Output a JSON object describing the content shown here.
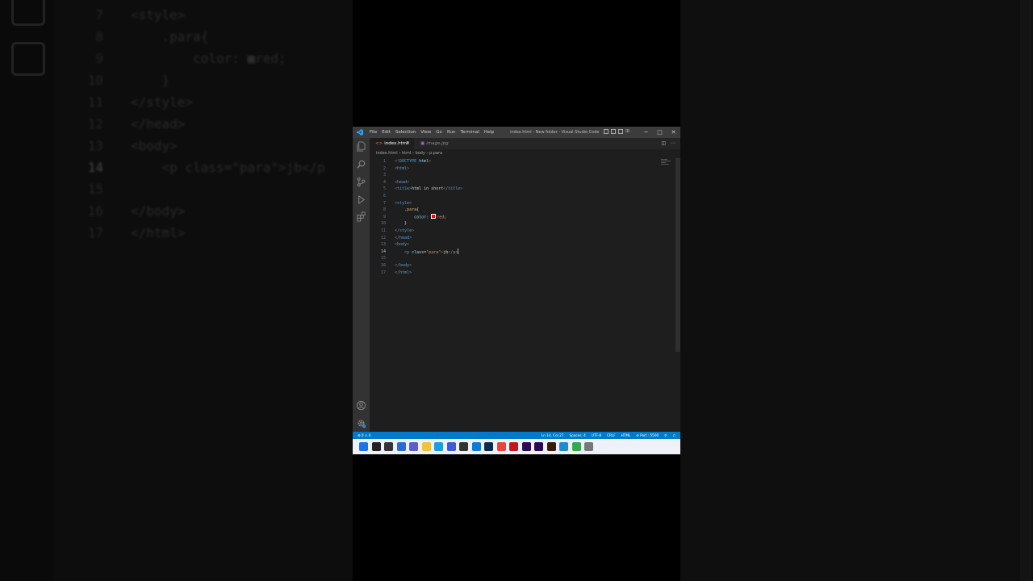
{
  "background": {
    "lines": [
      {
        "num": "7",
        "code": "<style>"
      },
      {
        "num": "8",
        "code": "    .para{"
      },
      {
        "num": "9",
        "code": "        color: ■red;"
      },
      {
        "num": "10",
        "code": "    }"
      },
      {
        "num": "11",
        "code": "</style>"
      },
      {
        "num": "12",
        "code": "</head>"
      },
      {
        "num": "13",
        "code": "<body>"
      },
      {
        "num": "14",
        "code": "    <p class=\"para\">jb</p"
      },
      {
        "num": "15",
        "code": ""
      },
      {
        "num": "16",
        "code": "</body>"
      },
      {
        "num": "17",
        "code": "</html>"
      }
    ]
  },
  "window": {
    "title": "index.html - New folder - Visual Studio Code",
    "menu": [
      "File",
      "Edit",
      "Selection",
      "View",
      "Go",
      "Run",
      "Terminal",
      "Help"
    ],
    "controls": {
      "minimize": "─",
      "maximize": "□",
      "close": "✕"
    }
  },
  "tabs": [
    {
      "label": "index.html",
      "active": true,
      "close": "✕"
    },
    {
      "label": "image.jpg",
      "active": false
    }
  ],
  "breadcrumb": [
    "index.html",
    "html",
    "body",
    "p.para"
  ],
  "editor": {
    "current_line": 14,
    "lines": [
      {
        "num": "1",
        "tokens": [
          [
            "br",
            "<!"
          ],
          [
            "tag",
            "DOCTYPE"
          ],
          [
            "text",
            " "
          ],
          [
            "attr",
            "html"
          ],
          [
            "br",
            ">"
          ]
        ]
      },
      {
        "num": "2",
        "tokens": [
          [
            "br",
            "<"
          ],
          [
            "tag",
            "html"
          ],
          [
            "br",
            ">"
          ]
        ]
      },
      {
        "num": "3",
        "tokens": []
      },
      {
        "num": "4",
        "tokens": [
          [
            "br",
            "<"
          ],
          [
            "tag",
            "head"
          ],
          [
            "br",
            ">"
          ]
        ]
      },
      {
        "num": "5",
        "tokens": [
          [
            "br",
            "<"
          ],
          [
            "tag",
            "title"
          ],
          [
            "br",
            ">"
          ],
          [
            "text",
            "html in short"
          ],
          [
            "br",
            "</"
          ],
          [
            "tag",
            "title"
          ],
          [
            "br",
            ">"
          ]
        ]
      },
      {
        "num": "6",
        "tokens": []
      },
      {
        "num": "7",
        "tokens": [
          [
            "br",
            "<"
          ],
          [
            "tag",
            "style"
          ],
          [
            "br",
            ">"
          ]
        ]
      },
      {
        "num": "8",
        "tokens": [
          [
            "text",
            "    "
          ],
          [
            "sel",
            ".para"
          ],
          [
            "text",
            "{"
          ]
        ]
      },
      {
        "num": "9",
        "tokens": [
          [
            "text",
            "        "
          ],
          [
            "prop",
            "color"
          ],
          [
            "text",
            ": "
          ],
          [
            "swatch",
            ""
          ],
          [
            "str",
            "red"
          ],
          [
            "text",
            ";"
          ]
        ]
      },
      {
        "num": "10",
        "tokens": [
          [
            "text",
            "    }"
          ]
        ]
      },
      {
        "num": "11",
        "tokens": [
          [
            "br",
            "</"
          ],
          [
            "tag",
            "style"
          ],
          [
            "br",
            ">"
          ]
        ]
      },
      {
        "num": "12",
        "tokens": [
          [
            "br",
            "</"
          ],
          [
            "tag",
            "head"
          ],
          [
            "br",
            ">"
          ]
        ]
      },
      {
        "num": "13",
        "tokens": [
          [
            "br",
            "<"
          ],
          [
            "tag",
            "body"
          ],
          [
            "br",
            ">"
          ]
        ]
      },
      {
        "num": "14",
        "tokens": [
          [
            "text",
            "    "
          ],
          [
            "br",
            "<"
          ],
          [
            "tag",
            "p"
          ],
          [
            "text",
            " "
          ],
          [
            "attr",
            "class"
          ],
          [
            "text",
            "="
          ],
          [
            "str",
            "\"para\""
          ],
          [
            "br",
            ">"
          ],
          [
            "text",
            "jb"
          ],
          [
            "br",
            "</"
          ],
          [
            "tag",
            "p"
          ],
          [
            "br",
            ">"
          ],
          [
            "cursor",
            ""
          ]
        ]
      },
      {
        "num": "15",
        "tokens": []
      },
      {
        "num": "16",
        "tokens": [
          [
            "br",
            "</"
          ],
          [
            "tag",
            "body"
          ],
          [
            "br",
            ">"
          ]
        ]
      },
      {
        "num": "17",
        "tokens": [
          [
            "br",
            "</"
          ],
          [
            "tag",
            "html"
          ],
          [
            "br",
            ">"
          ]
        ]
      }
    ]
  },
  "statusbar": {
    "problems": "⊗ 0 ⚠ 0",
    "position": "Ln 14, Col 27",
    "spaces": "Spaces: 4",
    "encoding": "UTF-8",
    "eol": "CRLF",
    "language": "HTML",
    "port": "⊘ Port : 5500"
  },
  "taskbar": {
    "apps": [
      {
        "name": "start",
        "color": "#1a73e8"
      },
      {
        "name": "search",
        "color": "#222222"
      },
      {
        "name": "task-view",
        "color": "#333333"
      },
      {
        "name": "widgets",
        "color": "#2b6cd4"
      },
      {
        "name": "chat",
        "color": "#5b5fc7"
      },
      {
        "name": "file-explorer",
        "color": "#f3c13a"
      },
      {
        "name": "edge",
        "color": "#1b9de2"
      },
      {
        "name": "store",
        "color": "#3b5bdb"
      },
      {
        "name": "app-dark",
        "color": "#333333"
      },
      {
        "name": "app-blue",
        "color": "#0f7bd6"
      },
      {
        "name": "photoshop",
        "color": "#0c2b4a"
      },
      {
        "name": "chrome",
        "color": "#e8453c"
      },
      {
        "name": "acrobat",
        "color": "#c4161c"
      },
      {
        "name": "after-effects",
        "color": "#2b0a5a"
      },
      {
        "name": "premiere",
        "color": "#2a0a4f"
      },
      {
        "name": "illustrator",
        "color": "#3a1a08"
      },
      {
        "name": "vscode",
        "color": "#1f8ad2"
      },
      {
        "name": "chrome-2",
        "color": "#34a853"
      },
      {
        "name": "app-light",
        "color": "#777777"
      }
    ]
  }
}
